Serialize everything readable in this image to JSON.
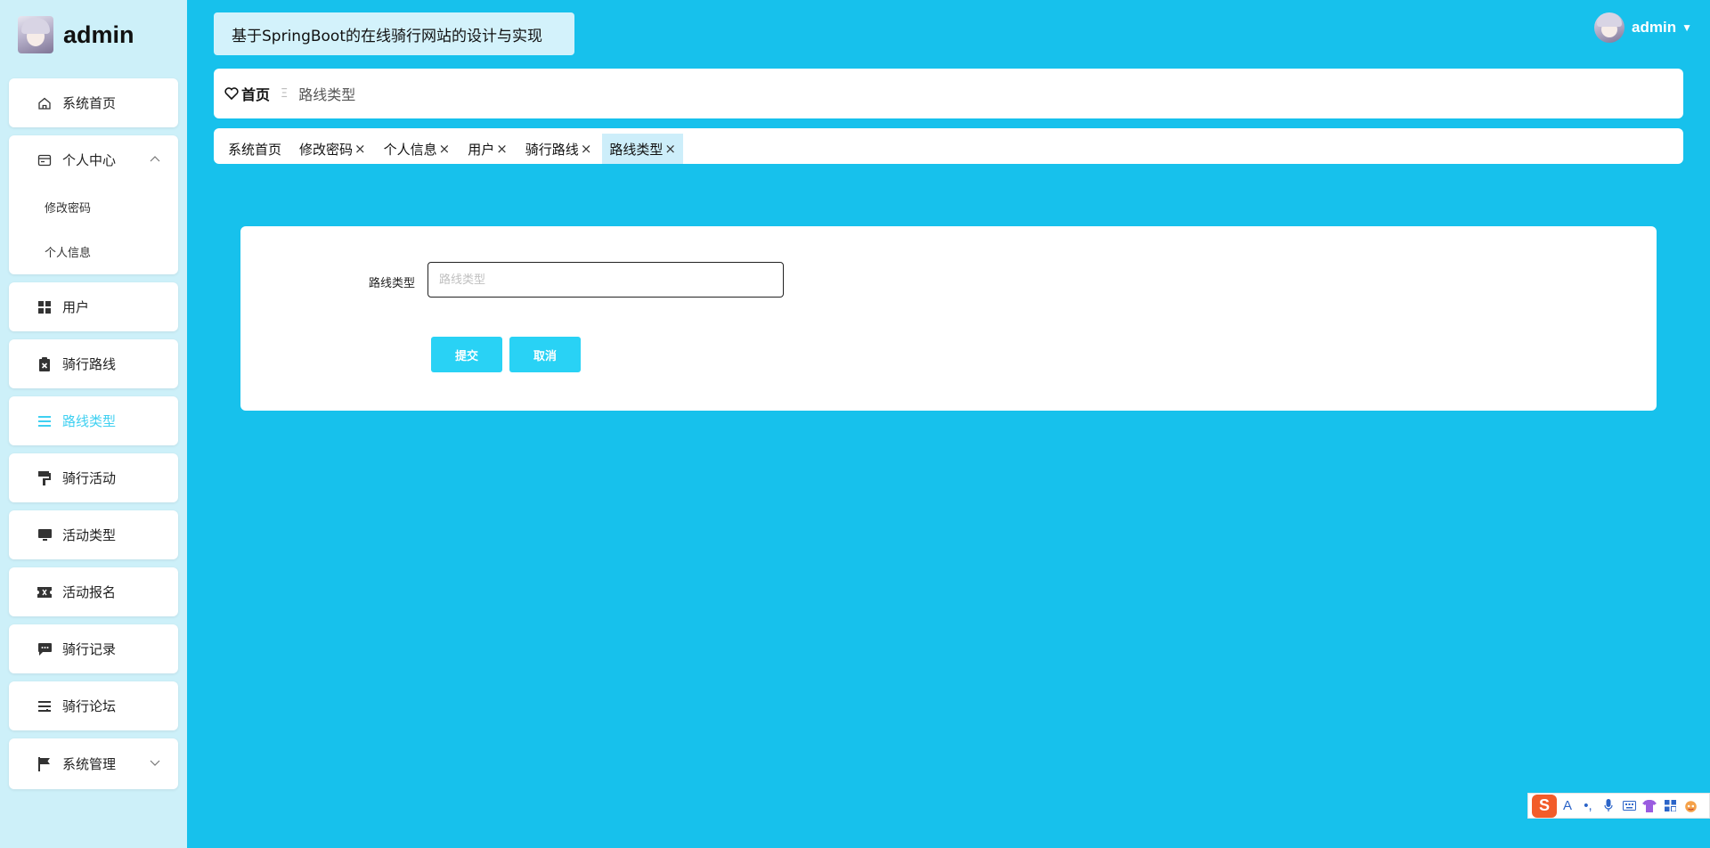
{
  "sidebar": {
    "brand_name": "admin",
    "menu": [
      {
        "label": "系统首页",
        "icon": "home-icon"
      },
      {
        "label": "个人中心",
        "icon": "profile-icon",
        "expanded": true,
        "sub": [
          "修改密码",
          "个人信息"
        ]
      },
      {
        "label": "用户",
        "icon": "grid-icon"
      },
      {
        "label": "骑行路线",
        "icon": "clipboard-icon"
      },
      {
        "label": "路线类型",
        "icon": "list-icon",
        "active": true
      },
      {
        "label": "骑行活动",
        "icon": "paint-roller-icon"
      },
      {
        "label": "活动类型",
        "icon": "monitor-icon"
      },
      {
        "label": "活动报名",
        "icon": "ticket-icon"
      },
      {
        "label": "骑行记录",
        "icon": "message-icon"
      },
      {
        "label": "骑行论坛",
        "icon": "sliders-icon"
      },
      {
        "label": "系统管理",
        "icon": "flag-icon",
        "expandable": true
      }
    ]
  },
  "header": {
    "site_title": "基于SpringBoot的在线骑行网站的设计与实现",
    "user_name": "admin"
  },
  "breadcrumb": {
    "home": "首页",
    "current": "路线类型"
  },
  "tabs": [
    {
      "label": "系统首页",
      "closable": false
    },
    {
      "label": "修改密码",
      "closable": true
    },
    {
      "label": "个人信息",
      "closable": true
    },
    {
      "label": "用户",
      "closable": true
    },
    {
      "label": "骑行路线",
      "closable": true
    },
    {
      "label": "路线类型",
      "closable": true,
      "active": true
    }
  ],
  "form": {
    "field_label": "路线类型",
    "field_placeholder": "路线类型",
    "field_value": "",
    "submit_label": "提交",
    "cancel_label": "取消"
  },
  "colors": {
    "background": "#17c1ec",
    "sidebar": "#cdf0f9",
    "accent": "#29d2f5",
    "active_menu_text": "#3fd0f1"
  }
}
